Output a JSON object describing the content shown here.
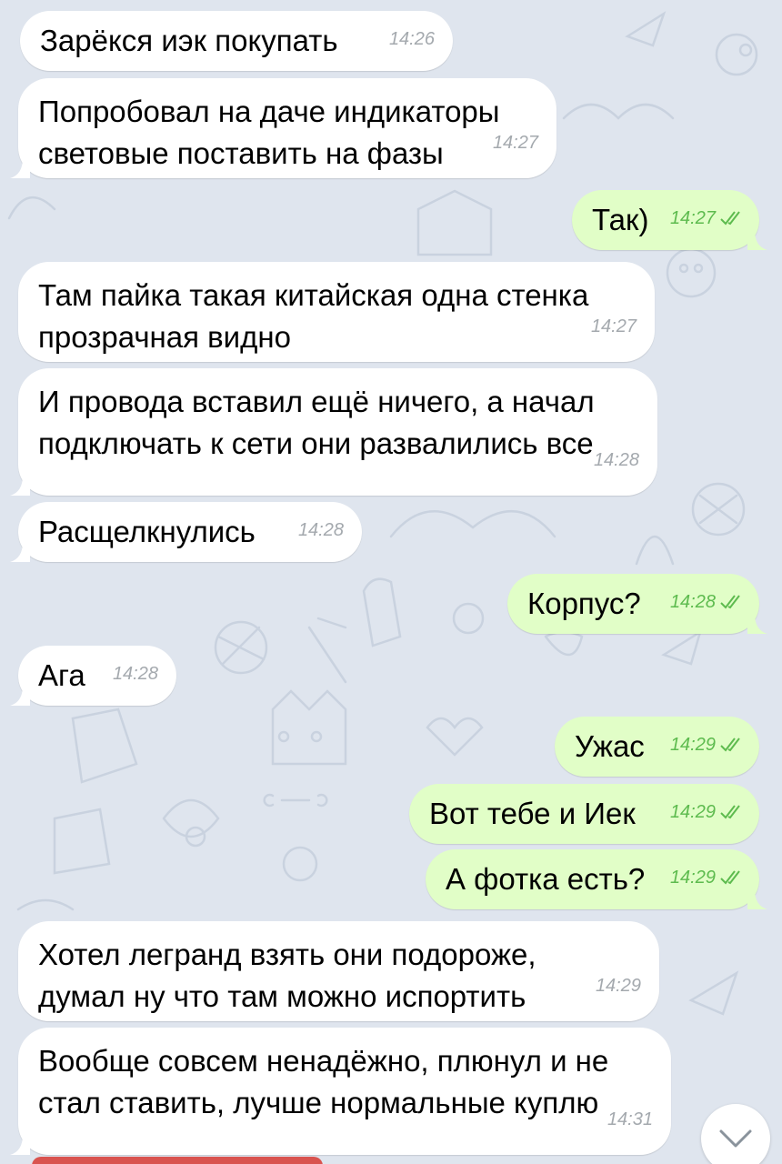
{
  "messages": [
    {
      "dir": "in",
      "text": "Зарёкся иэк покупать",
      "time": "14:26"
    },
    {
      "dir": "in",
      "text": "Попробовал на даче индикаторы\nсветовые поставить на фазы",
      "time": "14:27"
    },
    {
      "dir": "out",
      "text": "Так)",
      "time": "14:27",
      "read": true
    },
    {
      "dir": "in",
      "text": "Там пайка такая китайская одна стенка\nпрозрачная видно",
      "time": "14:27"
    },
    {
      "dir": "in",
      "text": "И провода вставил ещё ничего, а начал\nподключать к сети они развалились все",
      "time": "14:28"
    },
    {
      "dir": "in",
      "text": "Расщелкнулись",
      "time": "14:28"
    },
    {
      "dir": "out",
      "text": "Корпус?",
      "time": "14:28",
      "read": true
    },
    {
      "dir": "in",
      "text": "Ага",
      "time": "14:28"
    },
    {
      "dir": "out",
      "text": "Ужас",
      "time": "14:29",
      "read": true
    },
    {
      "dir": "out",
      "text": "Вот тебе и Иек",
      "time": "14:29",
      "read": true
    },
    {
      "dir": "out",
      "text": "А фотка есть?",
      "time": "14:29",
      "read": true
    },
    {
      "dir": "in",
      "text": "Хотел легранд взять они подороже,\nдумал ну что там можно испортить",
      "time": "14:29"
    },
    {
      "dir": "in",
      "text": "Вообще совсем ненадёжно, плюнул и не\nстал ставить, лучше нормальные куплю",
      "time": "14:31"
    }
  ],
  "icons": {
    "read_receipt": "double-check-icon",
    "scroll_down": "chevron-down-icon"
  },
  "colors": {
    "background": "#dfe5ee",
    "incoming_bubble": "#ffffff",
    "outgoing_bubble": "#e1fec7",
    "outgoing_time": "#5dbb4e",
    "incoming_time": "#a4a9ae"
  }
}
